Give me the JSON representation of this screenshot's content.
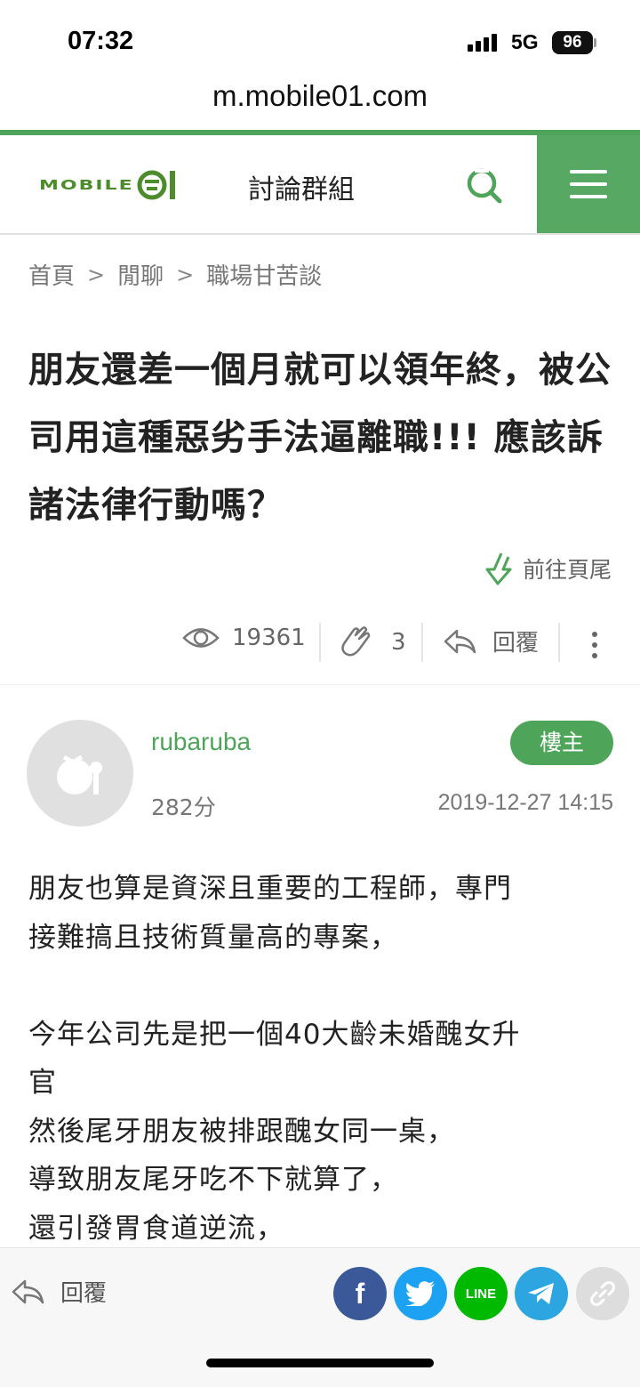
{
  "status": {
    "time": "07:32",
    "network": "5G",
    "battery": "96"
  },
  "browser": {
    "url": "m.mobile01.com"
  },
  "header": {
    "logo_text": "MOBILE",
    "section_title": "討論群組"
  },
  "breadcrumb": {
    "items": [
      "首頁",
      "閒聊",
      "職場甘苦談"
    ]
  },
  "post": {
    "title": "朋友還差一個月就可以領年終，被公司用這種惡劣手法逼離職!!! 應該訴諸法律行動嗎？",
    "goto_bottom": "前往頁尾",
    "views": "19361",
    "likes": "3",
    "reply_label": "回覆"
  },
  "author": {
    "name": "rubaruba",
    "badge": "樓主",
    "score": "282分",
    "date": "2019-12-27 14:15"
  },
  "body_lines": [
    "朋友也算是資深且重要的工程師，專門",
    "接難搞且技術質量高的專案，",
    "",
    "今年公司先是把一個40大齡未婚醜女升",
    "官",
    "然後尾牙朋友被排跟醜女同一桌，",
    "導致朋友尾牙吃不下就算了，",
    "還引發胃食道逆流，"
  ],
  "bottom_bar": {
    "reply_label": "回覆",
    "share": {
      "facebook": "f",
      "line": "LINE"
    },
    "colors": {
      "facebook": "#3b5998",
      "twitter": "#1da1f2",
      "line": "#00b900",
      "telegram": "#2ca5e0",
      "link": "#dddddd"
    }
  },
  "colors": {
    "brand_green": "#4ea55a",
    "logo_green": "#4c8c2b"
  }
}
